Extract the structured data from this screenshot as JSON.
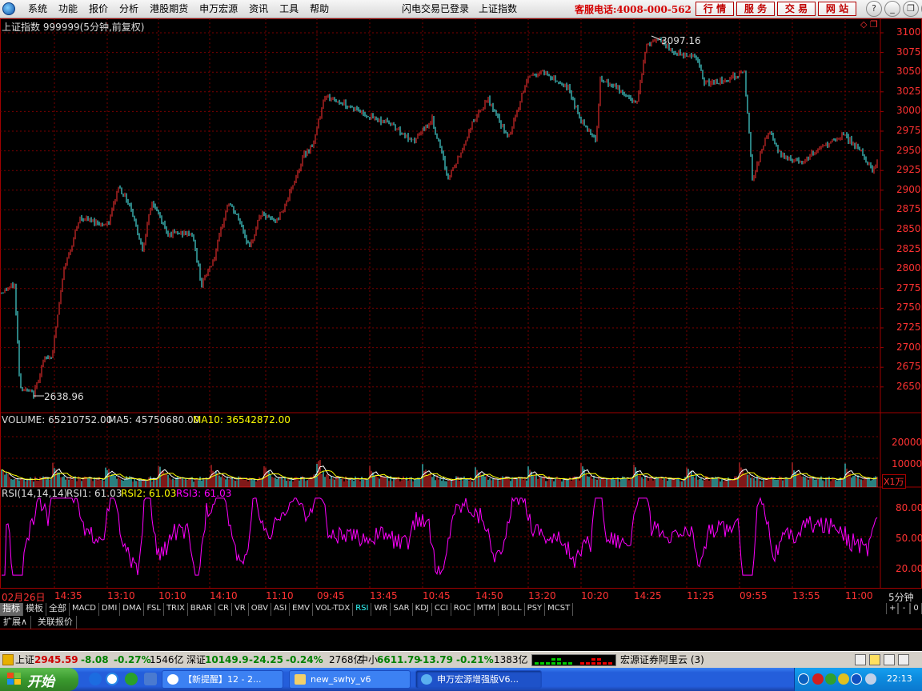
{
  "menu": {
    "items": [
      "系统",
      "功能",
      "报价",
      "分析",
      "港股期货",
      "申万宏源",
      "资讯",
      "工具",
      "帮助"
    ],
    "login_status": "闪电交易已登录",
    "current_index": "上证指数",
    "hotline": "客服电话:4008-000-562",
    "red_buttons": [
      "行 情",
      "服 务",
      "交 易",
      "网 站"
    ],
    "window_buttons": [
      "?",
      "_",
      "❐",
      "✕"
    ]
  },
  "chart": {
    "header": "上证指数 999999(5分钟,前复权)",
    "price_axis": [
      "3100",
      "3075",
      "3050",
      "3025",
      "3000",
      "2975",
      "2950",
      "2925",
      "2900",
      "2875",
      "2850",
      "2825",
      "2800",
      "2775",
      "2750",
      "2725",
      "2700",
      "2675",
      "2650"
    ],
    "high_label": "3097.16",
    "low_label": "2638.96",
    "volume_header": {
      "volume": "VOLUME: 65210752.00",
      "ma5": "MA5: 45750680.00",
      "ma10": "MA10: 36542872.00"
    },
    "volume_axis": [
      "20000",
      "10000"
    ],
    "volume_unit": "X1万",
    "rsi_header": {
      "name": "RSI(14,14,14)",
      "rsi1": "RSI1: 61.03",
      "rsi2": "RSI2: 61.03",
      "rsi3": "RSI3: 61.03"
    },
    "rsi_axis": [
      "80.00",
      "50.00",
      "20.00"
    ],
    "time_axis": [
      "02月26日",
      "14:35",
      "13:10",
      "10:10",
      "14:10",
      "11:10",
      "09:45",
      "13:45",
      "10:45",
      "14:50",
      "13:20",
      "10:20",
      "14:25",
      "11:25",
      "09:55",
      "13:55",
      "11:00"
    ],
    "period": "5分钟",
    "colors": {
      "up": "#ff3232",
      "down": "#54ffff",
      "grid": "#7a0000",
      "axis_text": "#ff3232",
      "ma5": "#ffffff",
      "ma10": "#ffff00",
      "rsi": "#ff00ff"
    }
  },
  "indicator_tabs": [
    "指标",
    "模板",
    "全部",
    "MACD",
    "DMI",
    "DMA",
    "FSL",
    "TRIX",
    "BRAR",
    "CR",
    "VR",
    "OBV",
    "ASI",
    "EMV",
    "VOL-TDX",
    "RSI",
    "WR",
    "SAR",
    "KDJ",
    "CCI",
    "ROC",
    "MTM",
    "BOLL",
    "PSY",
    "MCST"
  ],
  "active_tab": "RSI",
  "tab_controls": [
    "+",
    "-",
    "0"
  ],
  "ext_row": [
    "扩展∧",
    "关联报价"
  ],
  "status_bar": {
    "sh_label": "上证",
    "sh_value": "2945.59",
    "sh_change": "-8.08",
    "sh_pct": "-0.27%",
    "sh_amount": "1546亿",
    "sz_label": "深证",
    "sz_value": "10149.9",
    "sz_change": "-24.25",
    "sz_pct": "-0.24%",
    "sz_amount": "2768亿",
    "zx_label": "中小",
    "zx_value": "6611.79",
    "zx_change": "-13.79",
    "zx_pct": "-0.21%",
    "zx_amount": "1383亿",
    "server": "宏源证券阿里云 (3)"
  },
  "taskbar": {
    "start": "开始",
    "tasks": [
      "【新提醒】12 - 2...",
      "new_swhy_v6",
      "申万宏源增强版V6..."
    ],
    "clock": "22:13"
  }
}
